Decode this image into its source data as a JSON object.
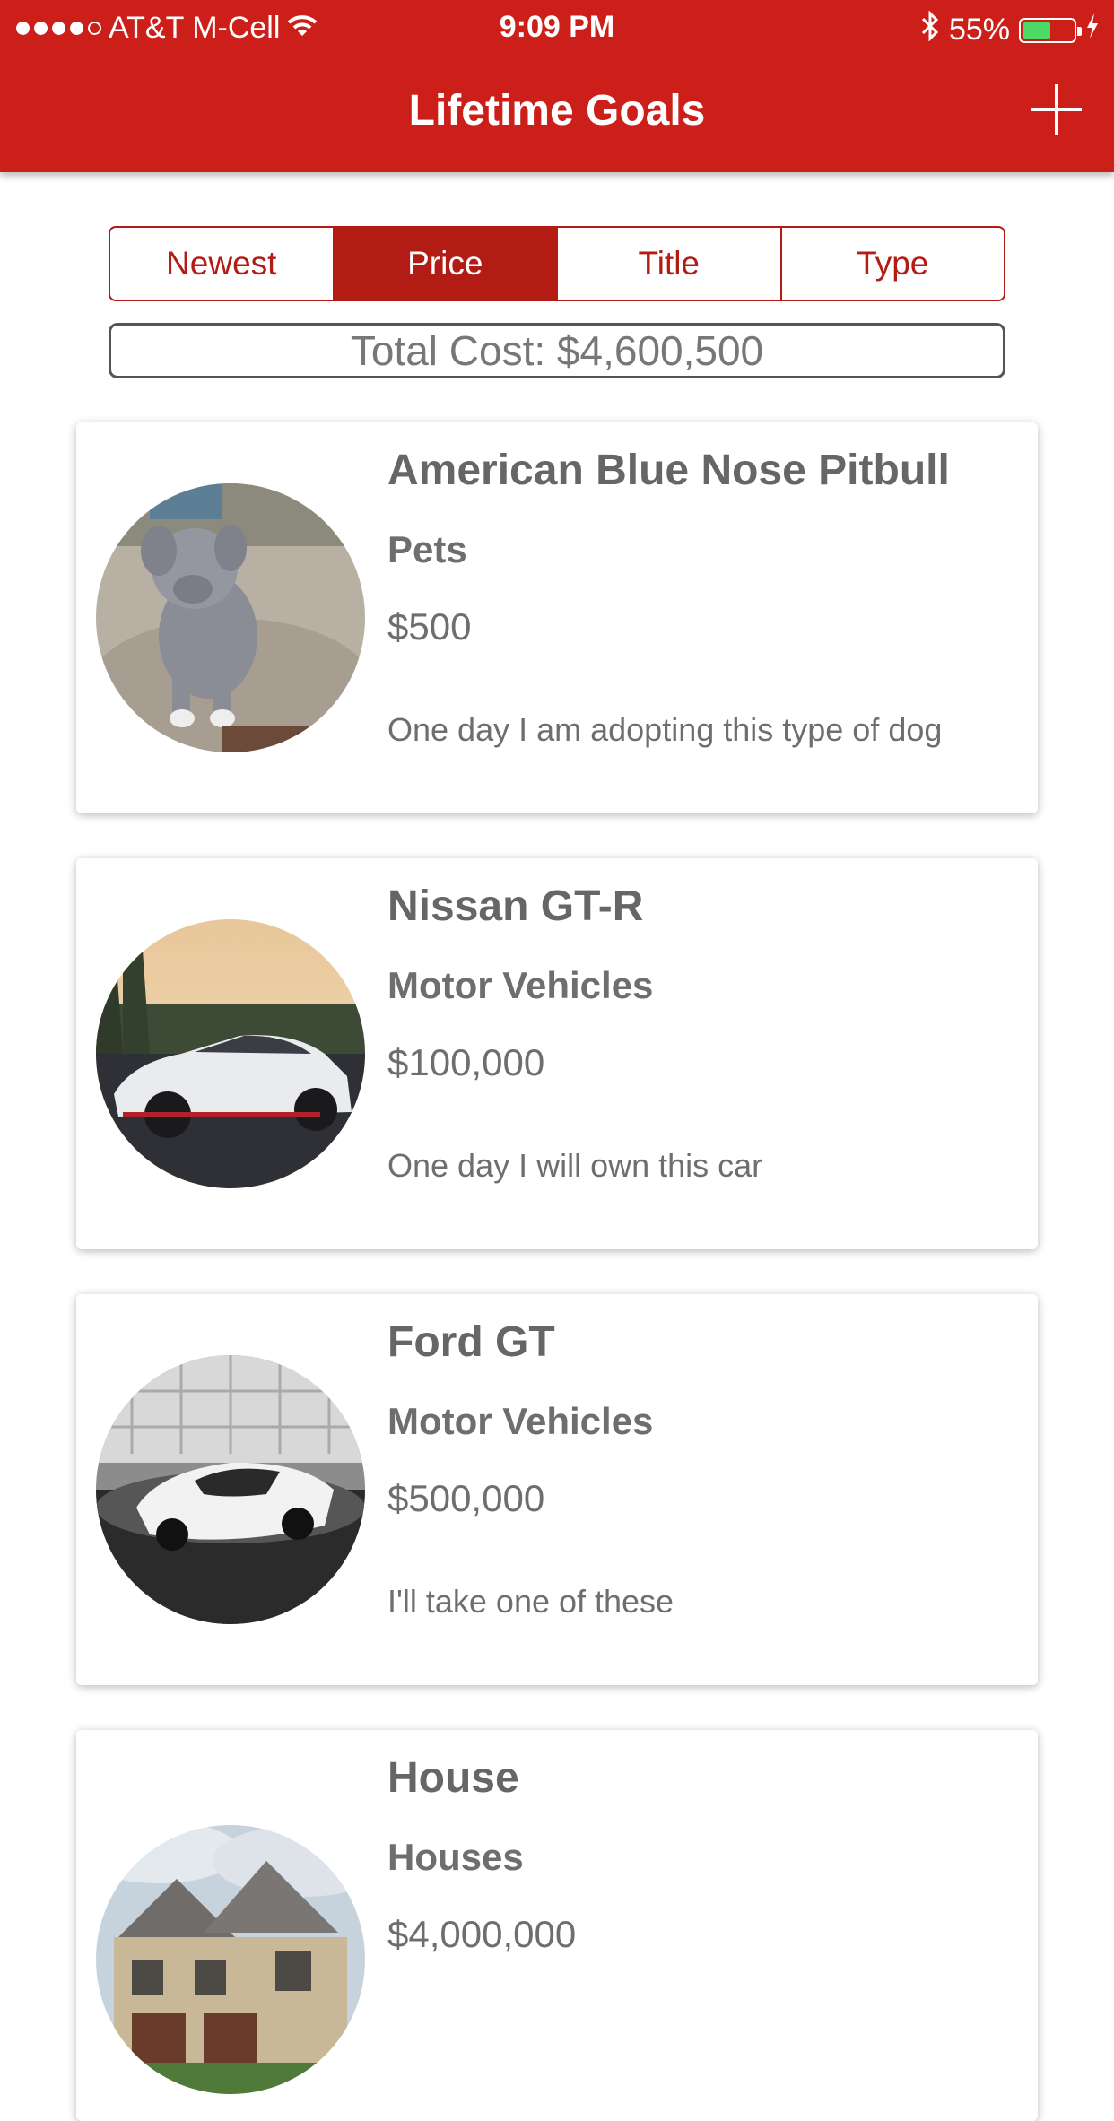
{
  "status_bar": {
    "carrier": "AT&T M-Cell",
    "time": "9:09 PM",
    "battery_percent": "55%",
    "battery_level": 0.55,
    "icons": [
      "signal-dots-icon",
      "wifi-icon",
      "bluetooth-icon",
      "battery-icon",
      "charging-bolt-icon"
    ]
  },
  "nav": {
    "title": "Lifetime Goals",
    "add_icon": "plus-icon"
  },
  "sort": {
    "options": [
      "Newest",
      "Price",
      "Title",
      "Type"
    ],
    "selected": "Price"
  },
  "summary": {
    "total_cost": "Total Cost: $4,600,500"
  },
  "colors": {
    "brand_red": "#cc1f19",
    "segment_red": "#b31b15",
    "text_gray": "#666666"
  },
  "goals": [
    {
      "name": "American Blue Nose Pitbull",
      "type": "Pets",
      "price": "$500",
      "description": "One day I am adopting this type of dog"
    },
    {
      "name": "Nissan GT-R",
      "type": "Motor Vehicles",
      "price": "$100,000",
      "description": "One day I will own this car"
    },
    {
      "name": "Ford GT",
      "type": "Motor Vehicles",
      "price": "$500,000",
      "description": "I'll take one of these"
    },
    {
      "name": "House",
      "type": "Houses",
      "price": "$4,000,000",
      "description": ""
    }
  ]
}
